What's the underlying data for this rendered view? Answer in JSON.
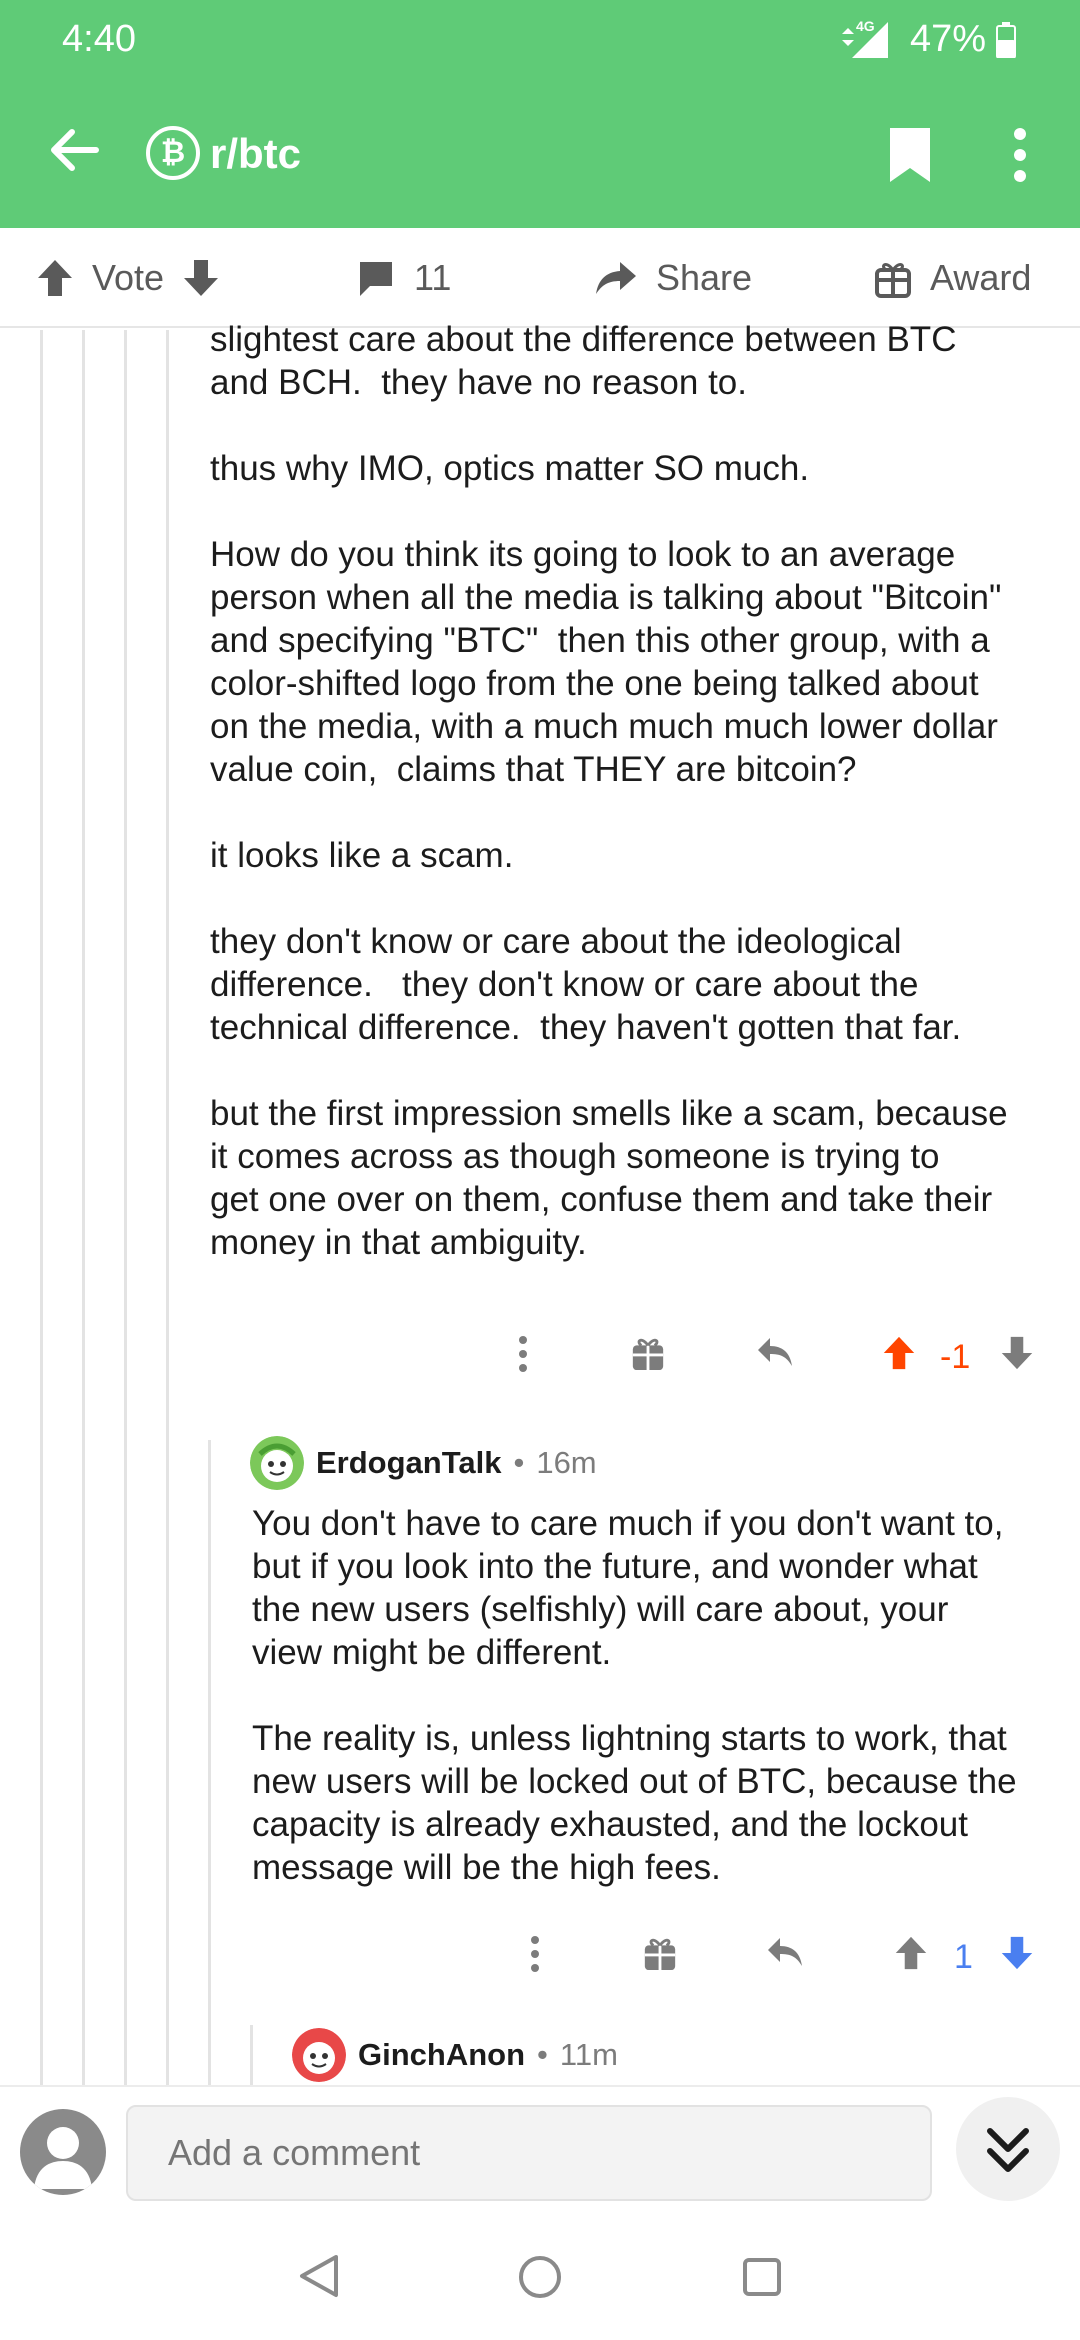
{
  "status_bar": {
    "time": "4:40",
    "network": "4G",
    "battery": "47%"
  },
  "app_bar": {
    "subreddit": "r/btc",
    "subreddit_icon": "₿"
  },
  "action_bar": {
    "vote_label": "Vote",
    "comments_count": "11",
    "share_label": "Share",
    "award_label": "Award"
  },
  "comment_1": {
    "paragraphs": [
      "slightest care about the difference between BTC\nand BCH.  they have no reason to.",
      "thus why IMO, optics matter SO much.",
      "How do you think its going to look to an average\nperson when all the media is talking about \"Bitcoin\"\nand specifying \"BTC\"  then this other group, with a\ncolor-shifted logo from the one being talked about\non the media, with a much much much lower dollar\nvalue coin,  claims that THEY are bitcoin?",
      "it looks like a scam.",
      "they don't know or care about the ideological\ndifference.   they don't know or care about the\ntechnical difference.  they haven't gotten that far.",
      "but the first impression smells like a scam, because\nit comes across as though someone is trying to\nget one over on them, confuse them and take their\nmoney in that ambiguity."
    ],
    "score": "-1",
    "vote_state": "upvoted",
    "vote_color": "#ff4500"
  },
  "comment_2": {
    "author": "ErdoganTalk",
    "time": "16m",
    "paragraphs": [
      "You don't have to care much if you don't want to,\nbut if you look into the future, and wonder what\nthe new users (selfishly) will care about, your\nview might be different.",
      "The reality is, unless lightning starts to work, that\nnew users will be locked out of BTC, because the\ncapacity is already exhausted, and the lockout\nmessage will be the high fees."
    ],
    "score": "1",
    "vote_state": "downvoted",
    "vote_color": "#4a7ff0"
  },
  "comment_3": {
    "author": "GinchAnon",
    "time": "11m"
  },
  "bottom_bar": {
    "comment_placeholder": "Add a comment"
  },
  "colors": {
    "brand_green": "#5fcb77",
    "upvote": "#ff4500",
    "downvote": "#4a7ff0"
  }
}
